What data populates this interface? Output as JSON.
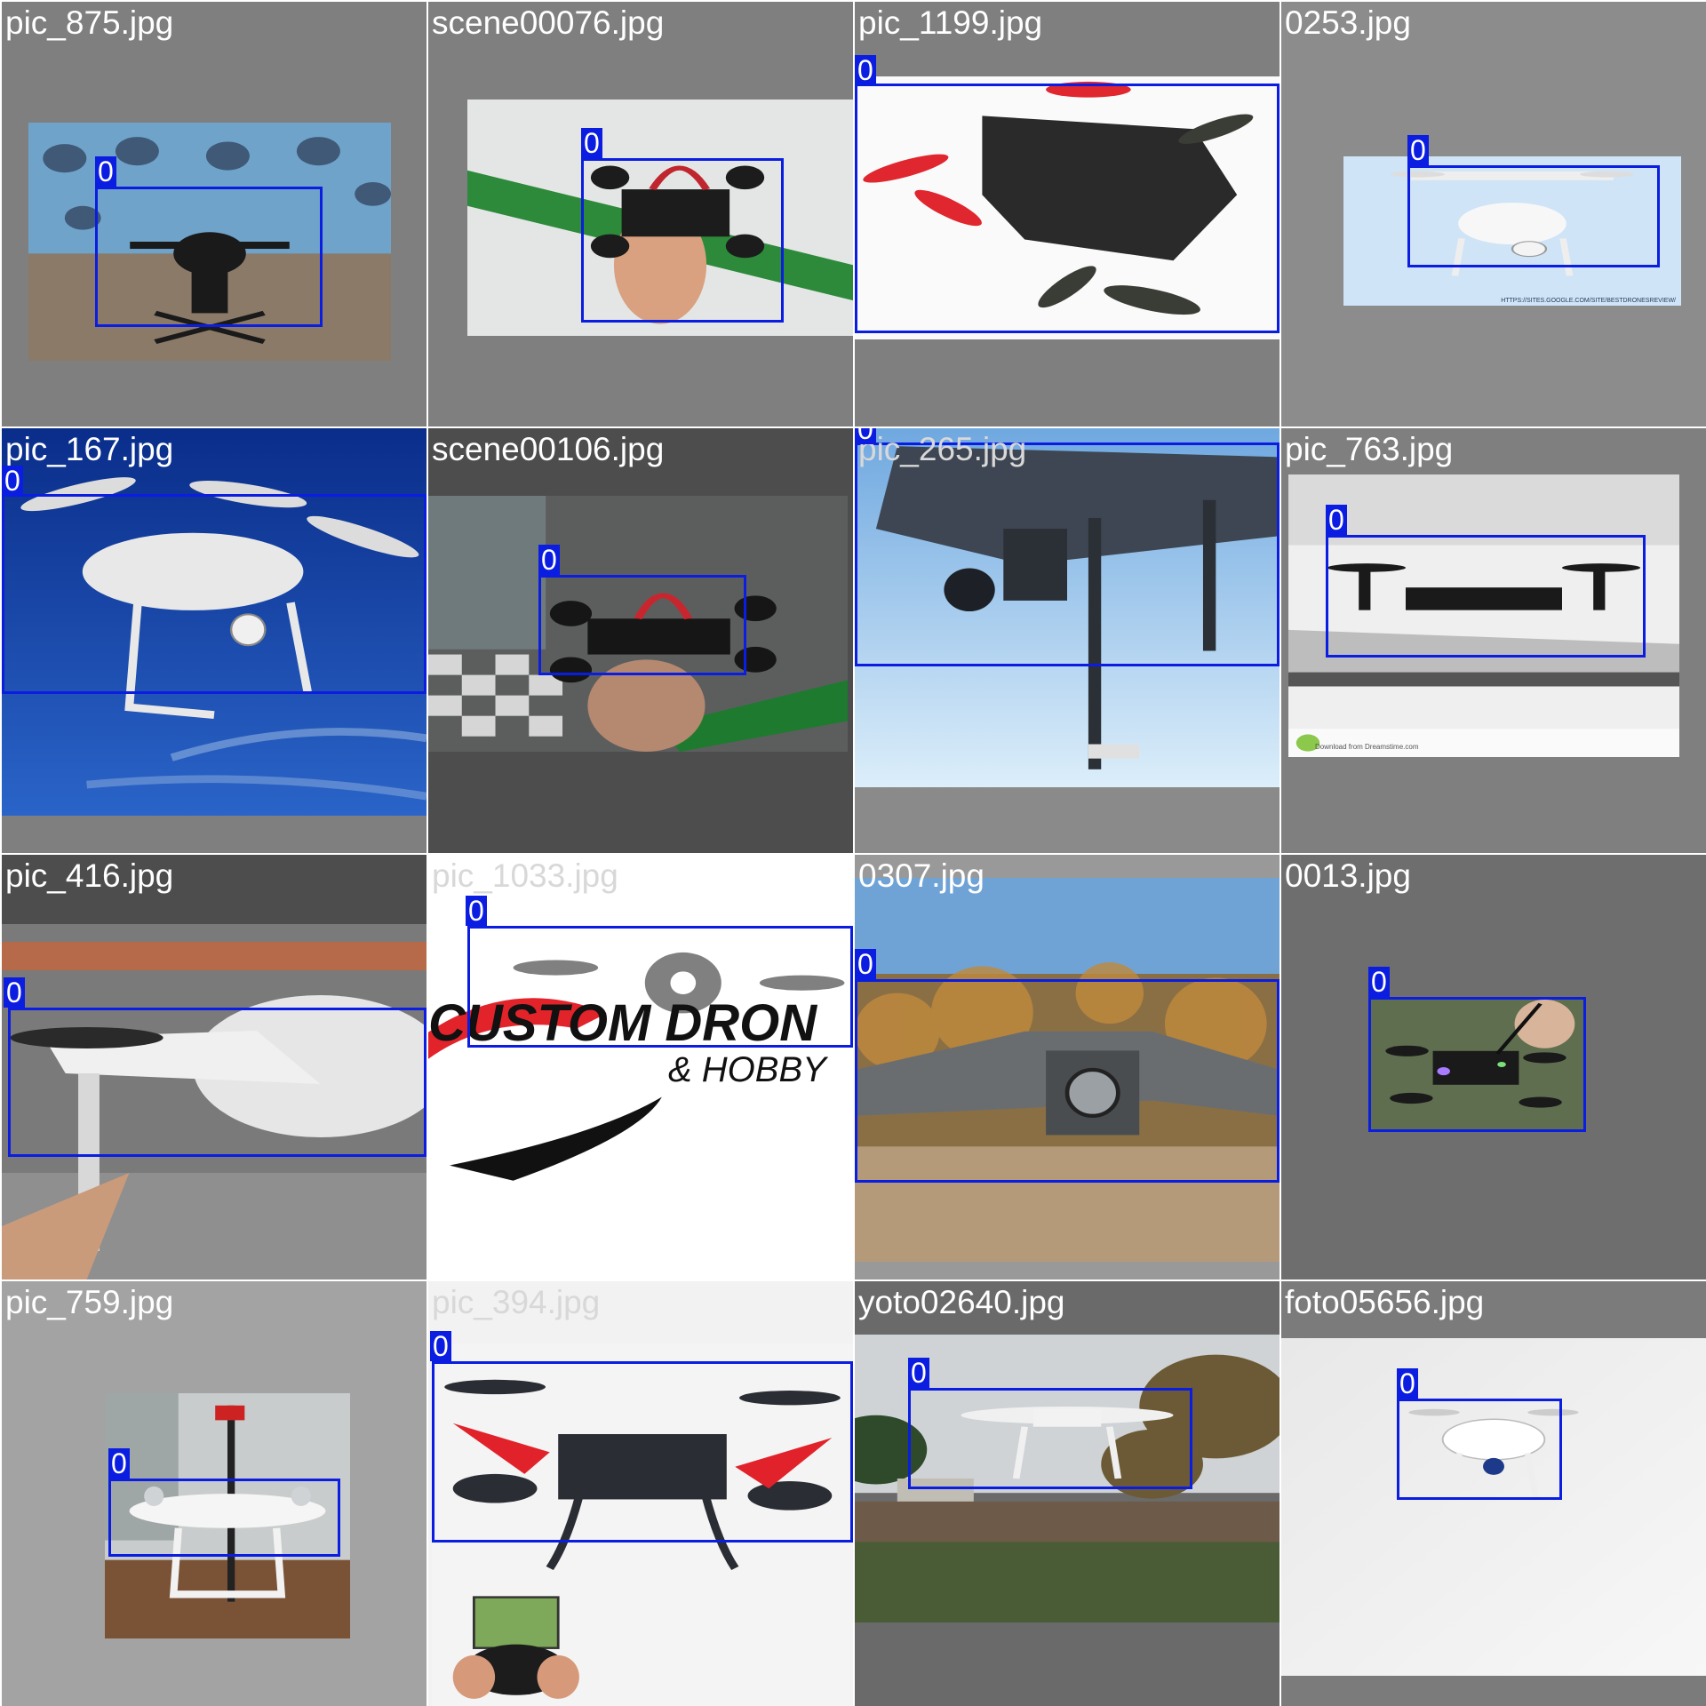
{
  "colors": {
    "tile_gray": "#7f7f7f",
    "tile_dark": "#4d4d4d",
    "box_blue": "#0a1de0",
    "label_white": "#ffffff"
  },
  "tiles": [
    {
      "filename": "pic_875.jpg",
      "scene": "hexacopter on stage with banner",
      "detections": [
        {
          "class_id": "0"
        }
      ]
    },
    {
      "filename": "scene00076.jpg",
      "scene": "hand holding small quadcopter",
      "detections": [
        {
          "class_id": "0"
        }
      ]
    },
    {
      "filename": "pic_1199.jpg",
      "scene": "carbon frame racing drone with red props",
      "detections": [
        {
          "class_id": "0"
        }
      ]
    },
    {
      "filename": "0253.jpg",
      "scene": "white quadcopter on light blue background",
      "watermark": "HTTPS://SITES.GOOGLE.COM/SITE/BESTDRONESREVIEW/",
      "detections": [
        {
          "class_id": "0"
        }
      ]
    },
    {
      "filename": "pic_167.jpg",
      "scene": "white drone in blue sky",
      "detections": [
        {
          "class_id": "0"
        }
      ]
    },
    {
      "filename": "scene00106.jpg",
      "scene": "hand holding quadcopter over checkered floor",
      "detections": [
        {
          "class_id": "0"
        }
      ]
    },
    {
      "filename": "pic_265.jpg",
      "scene": "industrial drone with gimbal camera close-up",
      "detections": [
        {
          "class_id": "0"
        }
      ]
    },
    {
      "filename": "pic_763.jpg",
      "scene": "black and white drone on glass table",
      "watermark": "Download from Dreamstime.com",
      "detections": [
        {
          "class_id": "0"
        }
      ]
    },
    {
      "filename": "pic_416.jpg",
      "scene": "white drone arm and propeller close-up",
      "detections": [
        {
          "class_id": "0"
        }
      ]
    },
    {
      "filename": "pic_1033.jpg",
      "scene": "custom drone hobby logo",
      "logo_text": [
        "CUSTOM DRON",
        "& HOBBY"
      ],
      "detections": [
        {
          "class_id": "0"
        }
      ]
    },
    {
      "filename": "0307.jpg",
      "scene": "grey foldable drone in front of trees",
      "detections": [
        {
          "class_id": "0"
        }
      ]
    },
    {
      "filename": "0013.jpg",
      "scene": "hand holding lit-up racing drone",
      "detections": [
        {
          "class_id": "0"
        }
      ]
    },
    {
      "filename": "pic_759.jpg",
      "scene": "white drone with antenna on wooden table",
      "detections": [
        {
          "class_id": "0"
        }
      ]
    },
    {
      "filename": "pic_394.jpg",
      "scene": "black and red quadcopter with controller",
      "detections": [
        {
          "class_id": "0"
        }
      ]
    },
    {
      "filename": "yoto02640.jpg",
      "scene": "white drone flying in backyard",
      "detections": [
        {
          "class_id": "0"
        }
      ]
    },
    {
      "filename": "foto05656.jpg",
      "scene": "white drone hovering over floor",
      "detections": [
        {
          "class_id": "0"
        }
      ]
    }
  ]
}
